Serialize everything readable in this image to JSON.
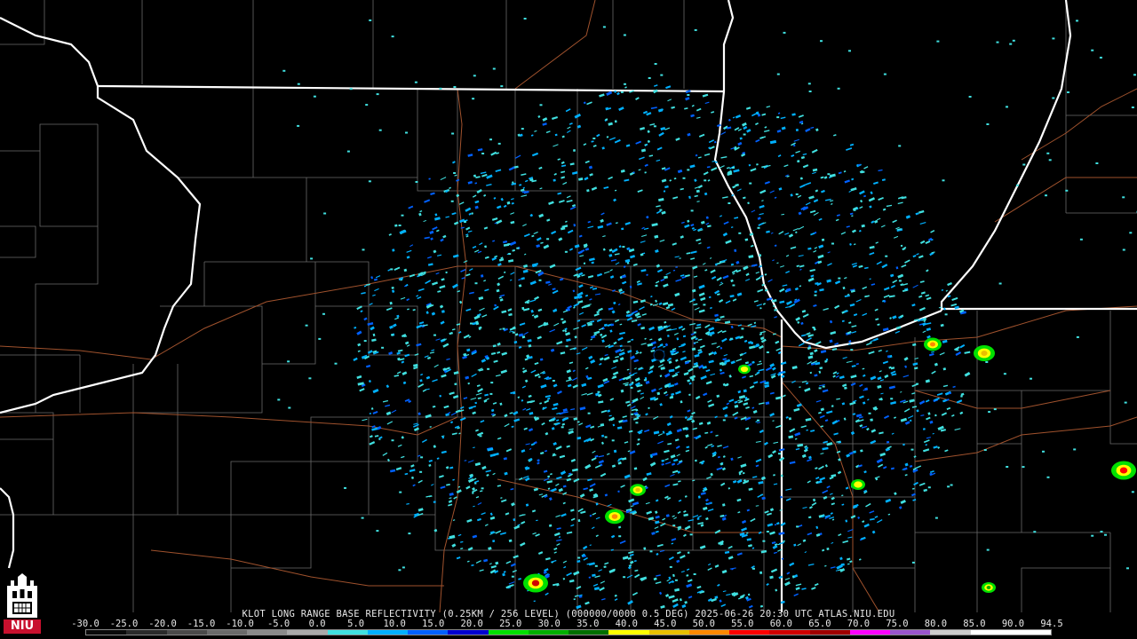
{
  "caption": "KLOT LONG RANGE BASE REFLECTIVITY (0.25KM / 256 LEVEL) (000000/0000 0.5 DEG) 2025-06-26 20:30 UTC  ATLAS.NIU.EDU",
  "logo_text": "NIU",
  "scale": {
    "labels": [
      "-30.0",
      "-25.0",
      "-20.0",
      "-15.0",
      "-10.0",
      "-5.0",
      "0.0",
      "5.0",
      "10.0",
      "15.0",
      "20.0",
      "25.0",
      "30.0",
      "35.0",
      "40.0",
      "45.0",
      "50.0",
      "55.0",
      "60.0",
      "65.0",
      "70.0",
      "75.0",
      "80.0",
      "85.0",
      "90.0",
      "94.5"
    ],
    "colors": [
      "#0a0a0a",
      "#2a2a2a",
      "#4a4a4a",
      "#6a6a6a",
      "#8a8a8a",
      "#aaaaaa",
      "#40e0e0",
      "#00b0ff",
      "#0060ff",
      "#0000d0",
      "#00e000",
      "#00b000",
      "#007000",
      "#ffff00",
      "#e8c000",
      "#ff8800",
      "#ff0000",
      "#d00000",
      "#a00000",
      "#ff00ff",
      "#9955cc",
      "#cccccc",
      "#ffffff",
      "#ffffff"
    ]
  },
  "storm_cells": [
    {
      "name": "cell-sw-1",
      "dbz": 55
    },
    {
      "name": "cell-s-1",
      "dbz": 45
    },
    {
      "name": "cell-s-2",
      "dbz": 40
    },
    {
      "name": "cell-ne-1",
      "dbz": 45
    },
    {
      "name": "cell-e-1",
      "dbz": 40
    },
    {
      "name": "cell-far-e-1",
      "dbz": 50
    },
    {
      "name": "cell-se-1",
      "dbz": 35
    },
    {
      "name": "cell-se-2",
      "dbz": 30
    },
    {
      "name": "cell-center-1",
      "dbz": 35
    }
  ]
}
